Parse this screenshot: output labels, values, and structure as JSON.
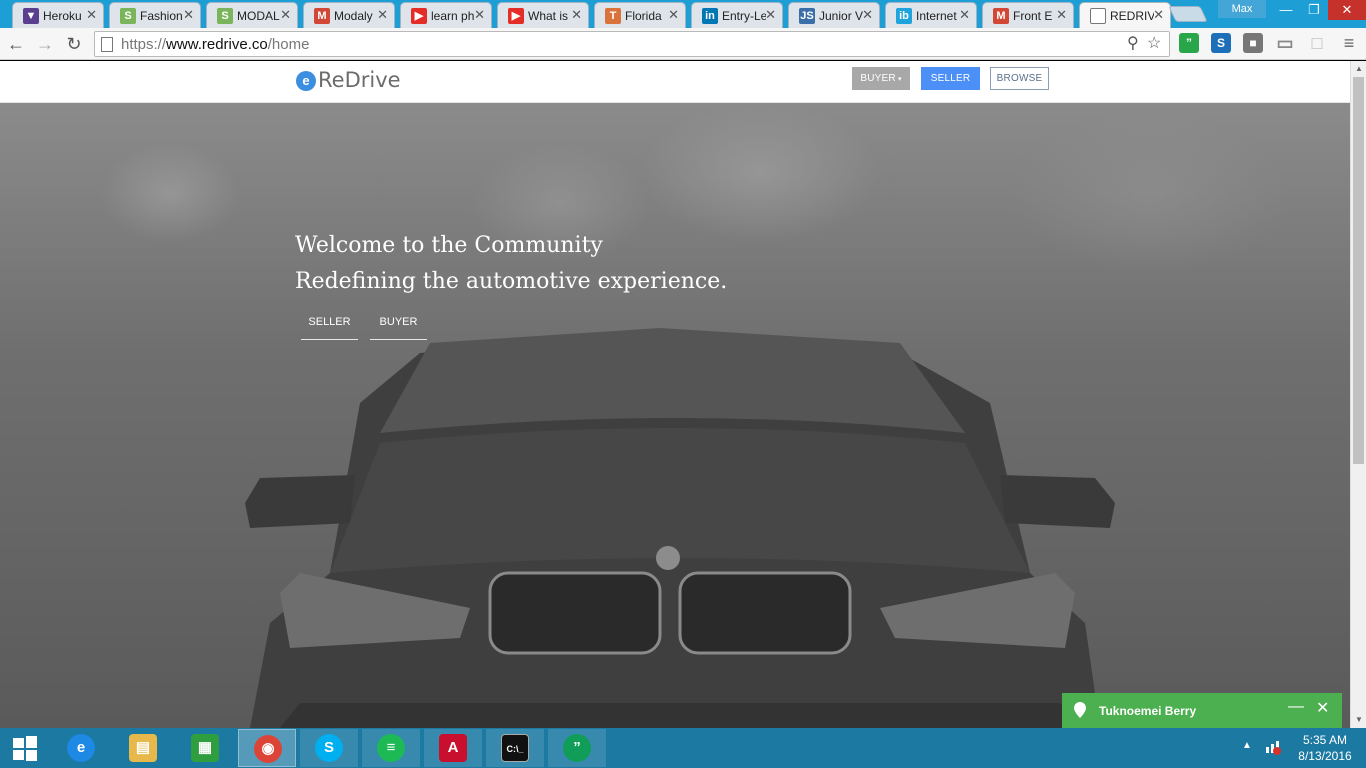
{
  "browser": {
    "tabs": [
      {
        "label": "Heroku",
        "icon": "heroku-icon",
        "icon_text": "▼",
        "color": "#5a3f8f"
      },
      {
        "label": "Fashion",
        "icon": "shopify-icon",
        "icon_text": "S",
        "color": "#7ab55c"
      },
      {
        "label": "MODAL",
        "icon": "shopify-icon",
        "icon_text": "S",
        "color": "#7ab55c"
      },
      {
        "label": "Modaly",
        "icon": "gmail-icon",
        "icon_text": "M",
        "color": "#d14836"
      },
      {
        "label": "learn ph",
        "icon": "youtube-icon",
        "icon_text": "▶",
        "color": "#e52d27"
      },
      {
        "label": "What is",
        "icon": "youtube-icon",
        "icon_text": "▶",
        "color": "#e52d27"
      },
      {
        "label": "Florida",
        "icon": "t-icon",
        "icon_text": "T",
        "color": "#d9733b"
      },
      {
        "label": "Entry-Le",
        "icon": "linkedin-icon",
        "icon_text": "in",
        "color": "#0077b5"
      },
      {
        "label": "Junior V",
        "icon": "js-icon",
        "icon_text": "JS",
        "color": "#3a6ea8"
      },
      {
        "label": "Internet",
        "icon": "ib-icon",
        "icon_text": "ib",
        "color": "#1fa3dc"
      },
      {
        "label": "Front E",
        "icon": "gmail-icon",
        "icon_text": "M",
        "color": "#d14836"
      },
      {
        "label": "REDRIV",
        "icon": "page-icon",
        "icon_text": "",
        "color": "#ffffff",
        "active": true
      }
    ],
    "user": "Max",
    "url_scheme": "https://",
    "url_host": "www.redrive.co",
    "url_path": "/home",
    "extensions": [
      {
        "name": "hangouts-ext-icon",
        "text": "”",
        "color": "#29a64a"
      },
      {
        "name": "s-ext-icon",
        "text": "S",
        "color": "#1d6fb8"
      },
      {
        "name": "shield-ext-icon",
        "text": "■",
        "color": "#777777"
      },
      {
        "name": "cast-icon",
        "text": "▭",
        "color": "#888888"
      },
      {
        "name": "ext-grey-icon",
        "text": "□",
        "color": "#bbbbbb"
      },
      {
        "name": "menu-icon",
        "text": "≡",
        "color": "#666666"
      }
    ]
  },
  "site": {
    "logo_mark": "e",
    "logo_text": "ReDrive",
    "nav": {
      "buyer": "BUYER",
      "seller": "SELLER",
      "browse": "BROWSE"
    },
    "hero": {
      "line1": "Welcome to the Community",
      "line2": "Redefining the automotive experience.",
      "seller_link": "SELLER",
      "buyer_link": "BUYER"
    },
    "colors": {
      "seller_button": "#4b8ff7",
      "buyer_button": "#a8a8a8",
      "logo": "#3c8fe0"
    }
  },
  "chat": {
    "name": "Tuknoemei Berry",
    "color": "#4caf50"
  },
  "taskbar": {
    "apps": [
      {
        "name": "start-icon"
      },
      {
        "name": "internet-explorer-icon",
        "text": "e",
        "color": "#1e88e5"
      },
      {
        "name": "file-explorer-icon",
        "text": "▤",
        "color": "#e8b84a"
      },
      {
        "name": "store-icon",
        "text": "▦",
        "color": "#2e9e3e"
      },
      {
        "name": "chrome-icon",
        "text": "◉",
        "color": "#db4437",
        "state": "active"
      },
      {
        "name": "skype-icon",
        "text": "S",
        "color": "#00aff0",
        "state": "open"
      },
      {
        "name": "spotify-icon",
        "text": "≡",
        "color": "#1db954",
        "state": "open"
      },
      {
        "name": "acrobat-icon",
        "text": "A",
        "color": "#c8102e",
        "state": "open"
      },
      {
        "name": "cmd-icon",
        "text": "C:\\_",
        "color": "#111111",
        "state": "open"
      },
      {
        "name": "hangouts-icon",
        "text": "”",
        "color": "#0f9d58",
        "state": "open"
      }
    ],
    "time": "5:35 AM",
    "date": "8/13/2016"
  }
}
